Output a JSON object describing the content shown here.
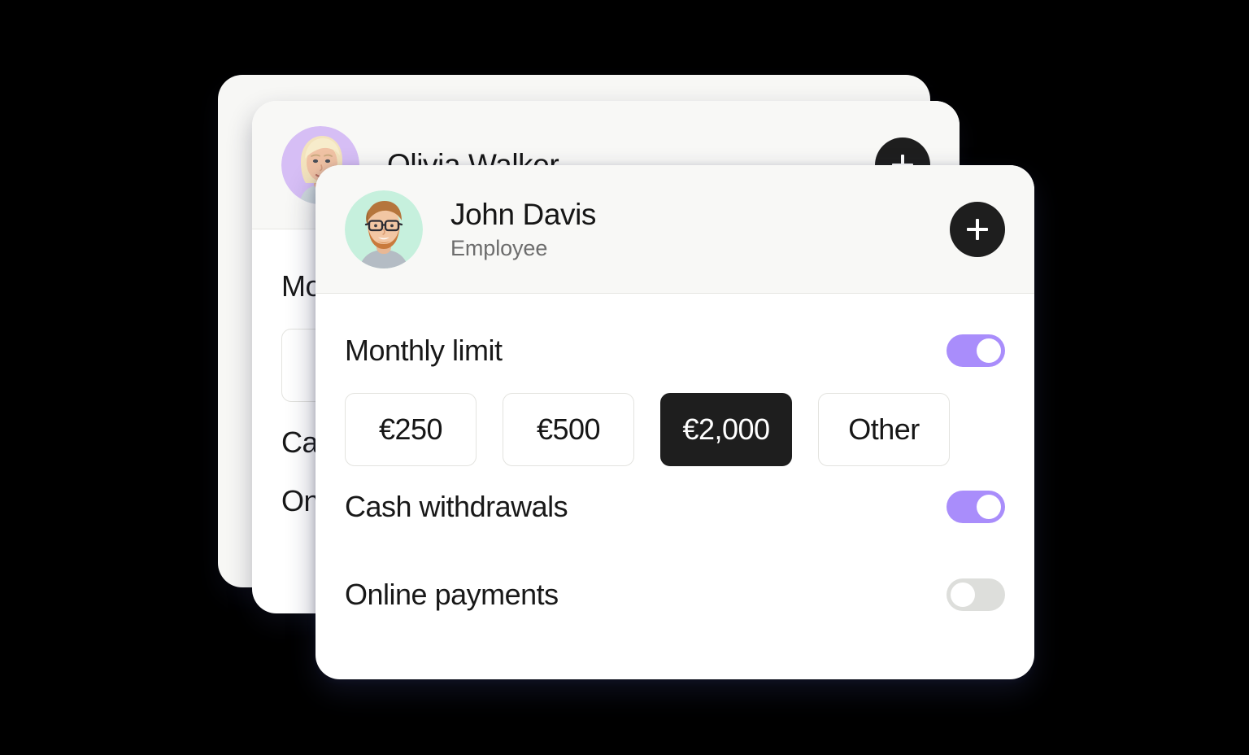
{
  "background_color": "#000000",
  "accent_color": "#a98dfb",
  "selected_chip_color": "#1e1e1e",
  "cards": {
    "back": {
      "visible_hint": "partially occluded empty card"
    },
    "middle": {
      "person": {
        "name": "Olivia Walker",
        "avatar_background": "#d6bef5",
        "avatar_alt": "portrait-olivia-walker"
      },
      "add_button_label": "+",
      "rows": [
        {
          "label": "Monthly limit",
          "visible_text": "Mo"
        },
        {
          "label": "Cash withdrawals",
          "visible_text": "Ca"
        },
        {
          "label": "Online payments",
          "visible_text": "On"
        }
      ],
      "amount_field_visible_text": "€"
    },
    "front": {
      "person": {
        "name": "John Davis",
        "role": "Employee",
        "avatar_background": "#c6f0dd",
        "avatar_alt": "portrait-john-davis"
      },
      "add_button_label": "+",
      "settings": [
        {
          "label": "Monthly limit",
          "state": "on"
        },
        {
          "label": "Cash withdrawals",
          "state": "on"
        },
        {
          "label": "Online payments",
          "state": "off"
        }
      ],
      "amount_options": [
        {
          "label": "€250",
          "selected": false
        },
        {
          "label": "€500",
          "selected": false
        },
        {
          "label": "€2,000",
          "selected": true
        },
        {
          "label": "Other",
          "selected": false
        }
      ]
    }
  }
}
